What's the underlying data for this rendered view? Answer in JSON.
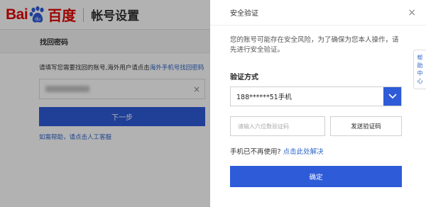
{
  "header": {
    "logo_left": "Bai",
    "logo_paw_text": "du",
    "logo_right": "百度",
    "title": "帐号设置"
  },
  "subheader": {
    "title": "找回密码"
  },
  "form": {
    "hint_text": "请填写您需要找回的账号,海外用户请点击",
    "hint_link": "海外手机号找回密码",
    "clear_icon": "×",
    "next_button": "下一步",
    "help_link": "如需帮助，请点击人工客服"
  },
  "help_tab": {
    "chars": [
      "帮",
      "助",
      "中",
      "心"
    ]
  },
  "dialog": {
    "title": "安全验证",
    "close_icon": "×",
    "notice": "您的账号可能存在安全风险，为了确保为您本人操作，请先进行安全验证。",
    "method_label": "验证方式",
    "phone_value": "188******51手机",
    "code_placeholder": "请输入六位数验证码",
    "send_code_button": "发送验证码",
    "unusable_text": "手机已不再使用?",
    "unusable_link": "点击此处解决",
    "confirm_button": "确定"
  },
  "colors": {
    "brand_red": "#e10602",
    "brand_blue": "#2e5bd8",
    "link_blue": "#2e65c8"
  },
  "icons": {
    "logo": "baidu-paw-icon",
    "close": "close-icon",
    "dropdown": "chevron-down-icon",
    "clear": "clear-icon"
  }
}
